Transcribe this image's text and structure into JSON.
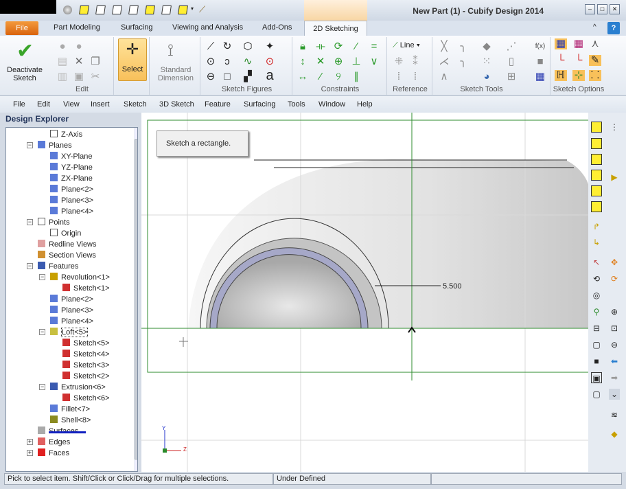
{
  "window": {
    "title": "New Part (1) - Cubify Design 2014",
    "buttons": [
      "minimize",
      "restore",
      "close"
    ]
  },
  "ribbon_tabs": [
    "File",
    "Part Modeling",
    "Surfacing",
    "Viewing and Analysis",
    "Add-Ons",
    "2D Sketching"
  ],
  "active_tab": "2D Sketching",
  "ribbon": {
    "deactivate_label": "Deactivate Sketch",
    "edit_label": "Edit",
    "select_label": "Select",
    "standard_dimension_label": "Standard Dimension",
    "sketch_figures_label": "Sketch Figures",
    "constraints_label": "Constraints",
    "reference_label": "Reference",
    "line_dropdown": "Line",
    "sketch_tools_label": "Sketch Tools",
    "sketch_options_label": "Sketch Options",
    "fx_label": "f(x)"
  },
  "menu": [
    "File",
    "Edit",
    "View",
    "Insert",
    "Sketch",
    "3D Sketch",
    "Feature",
    "Surfacing",
    "Tools",
    "Window",
    "Help"
  ],
  "explorer": {
    "title": "Design Explorer",
    "items": [
      "Z-Axis",
      "Planes",
      "XY-Plane",
      "YZ-Plane",
      "ZX-Plane",
      "Plane<2>",
      "Plane<3>",
      "Plane<4>",
      "Points",
      "Origin",
      "Redline Views",
      "Section Views",
      "Features",
      "Revolution<1>",
      "Sketch<1>",
      "Plane<2>",
      "Plane<3>",
      "Plane<4>",
      "Loft<5>",
      "Sketch<5>",
      "Sketch<4>",
      "Sketch<3>",
      "Sketch<2>",
      "Extrusion<6>",
      "Sketch<6>",
      "Fillet<7>",
      "Shell<8>",
      "Surfaces",
      "Edges",
      "Faces"
    ]
  },
  "viewport": {
    "tooltip": "Sketch a rectangle.",
    "dimension": "5.500",
    "axis_y": "Y",
    "axis_z": "Z",
    "sketch_color": "#2e8b2e"
  },
  "status": {
    "message": "Pick to select item. Shift/Click or Click/Drag for multiple selections.",
    "state": "Under Defined"
  }
}
